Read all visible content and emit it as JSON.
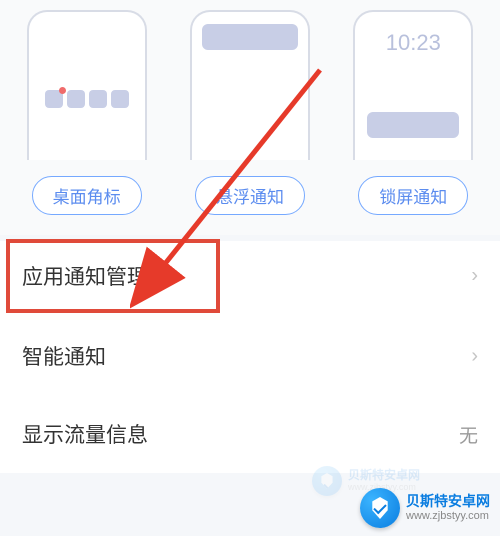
{
  "notification_types": [
    {
      "label": "桌面角标",
      "preview": "desktop"
    },
    {
      "label": "悬浮通知",
      "preview": "banner"
    },
    {
      "label": "锁屏通知",
      "preview": "lock",
      "time": "10:23"
    }
  ],
  "list": {
    "app_management": {
      "label": "应用通知管理"
    },
    "smart_notify": {
      "label": "智能通知"
    },
    "show_traffic": {
      "label": "显示流量信息",
      "value": "无"
    }
  },
  "watermark": {
    "title": "贝斯特安卓网",
    "url": "www.zjbstyy.com"
  }
}
